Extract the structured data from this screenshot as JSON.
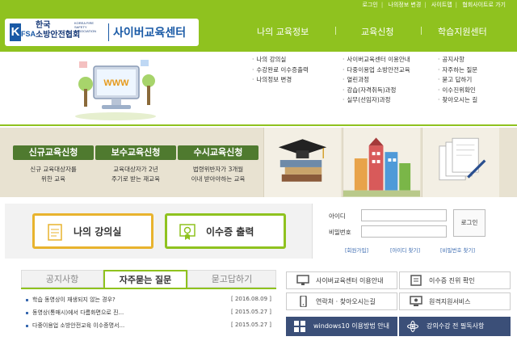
{
  "top_links": [
    "로그인",
    "나의정보 변경",
    "사이트맵",
    "협회사이트로 가기"
  ],
  "logo": {
    "k": "K",
    "fsa": "FSA",
    "ko_line1": "한국",
    "ko_line2": "소방안전협회",
    "en": "KOREA FIRE SAFETY ASSOCIATION",
    "center": "사이버교육센터"
  },
  "gnb": [
    "나의 교육정보",
    "교육신청",
    "학습지원센터"
  ],
  "illustration_text": "WWW",
  "submenu": {
    "col1": [
      "나의 강의실",
      "수강완료 이수증출력",
      "나의정보 변경"
    ],
    "col2": [
      "사이버교육센터 이용안내",
      "다중이용업 소방안전교육",
      "열린과정",
      "강습(자격취득)과정",
      "실무(선임자)과정"
    ],
    "col3": [
      "공지사항",
      "자주하는 질문",
      "묻고 답하기",
      "이수진위확인",
      "찾아오시는 길"
    ]
  },
  "courses": [
    {
      "title": "신규교육신청",
      "desc1": "신규 교육대상자를",
      "desc2": "위한 교육"
    },
    {
      "title": "보수교육신청",
      "desc1": "교육대상자가 2년",
      "desc2": "주기로 받는 재교육"
    },
    {
      "title": "수시교육신청",
      "desc1": "법령위반자가 3개월",
      "desc2": "이내 받아야하는 교육"
    }
  ],
  "quick": {
    "classroom": "나의 강의실",
    "certificate": "이수증 출력"
  },
  "login": {
    "id_label": "아이디",
    "pw_label": "비밀번호",
    "button": "로그인",
    "join": "[회원가입]",
    "find_id": "[아이디 찾기]",
    "find_pw": "[비밀번호 찾기]"
  },
  "tabs": [
    "공지사항",
    "자주묻는 질문",
    "묻고답하기"
  ],
  "posts": [
    {
      "title": "학습 동영상이 재생되지 않는 경우?",
      "date": "[ 2016.08.09 ]"
    },
    {
      "title": "동영상(통매시)에서 다름화면으로 진...",
      "date": "[ 2015.05.27 ]"
    },
    {
      "title": "다중이용업 소방안전교육 이수증명서...",
      "date": "[ 2015.05.27 ]"
    }
  ],
  "quick_links": [
    "사이버교육센터 이용안내",
    "이수증 진위 확인",
    "연락처 · 찾아오시는길",
    "원격지원서비스"
  ],
  "dark_buttons": [
    "windows10 이용방법 안내",
    "강의수강 전 필독사항"
  ],
  "colors": {
    "brand_green": "#8fc21f",
    "course_green": "#4f7a2f",
    "navy": "#3b4f78",
    "logo_blue": "#1a5aa6"
  }
}
